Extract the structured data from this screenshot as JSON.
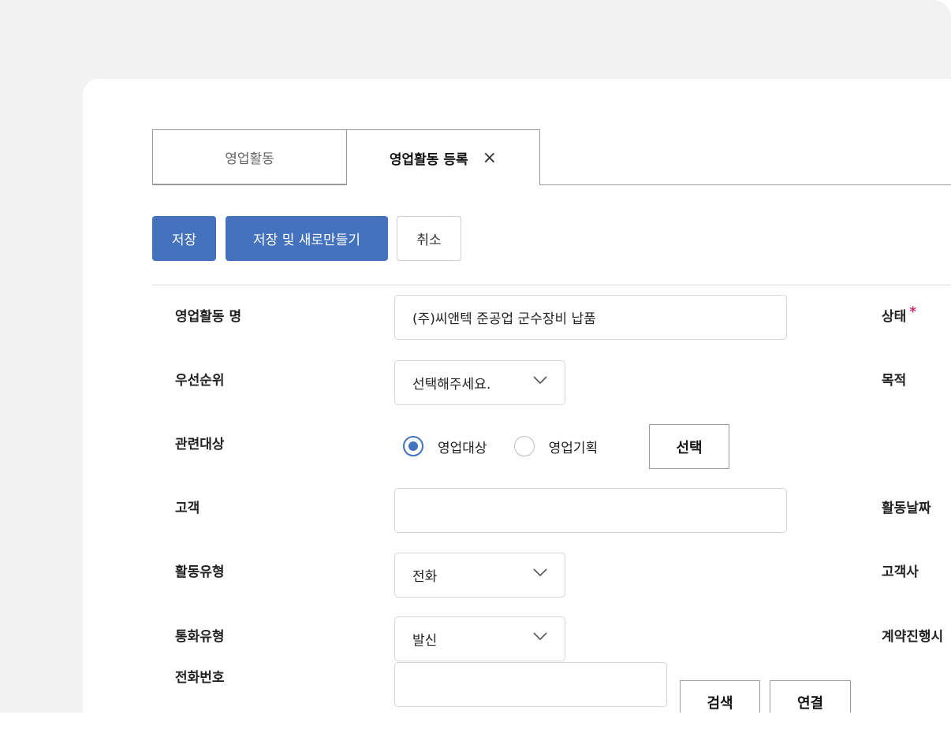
{
  "tabs": [
    {
      "label": "영업활동"
    },
    {
      "label": "영업활동 등록",
      "close_icon": "×"
    }
  ],
  "toolbar": {
    "save_label": "저장",
    "save_new_label": "저장 및 새로만들기",
    "cancel_label": "취소"
  },
  "form": {
    "activity_name": {
      "label": "영업활동 명",
      "value": "(주)씨앤텍 준공업 군수장비 납품"
    },
    "priority": {
      "label": "우선순위",
      "value": "선택해주세요."
    },
    "related_target": {
      "label": "관련대상",
      "options": [
        "영업대상",
        "영업기획"
      ],
      "selected": "영업대상",
      "select_button": "선택"
    },
    "customer": {
      "label": "고객",
      "value": ""
    },
    "activity_type": {
      "label": "활동유형",
      "value": "전화"
    },
    "call_type": {
      "label": "통화유형",
      "value": "발신"
    },
    "phone": {
      "label": "전화번호",
      "value": "",
      "search_button": "검색",
      "connect_button": "연결"
    }
  },
  "right_labels": {
    "status": "상태",
    "status_required_mark": "*",
    "purpose": "목적",
    "activity_date": "활동날짜",
    "client_company": "고객사",
    "contract_progress": "계약진행시"
  },
  "colors": {
    "primary": "#4472bd",
    "required": "#d6266b",
    "backdrop": "#f2f2f2"
  }
}
